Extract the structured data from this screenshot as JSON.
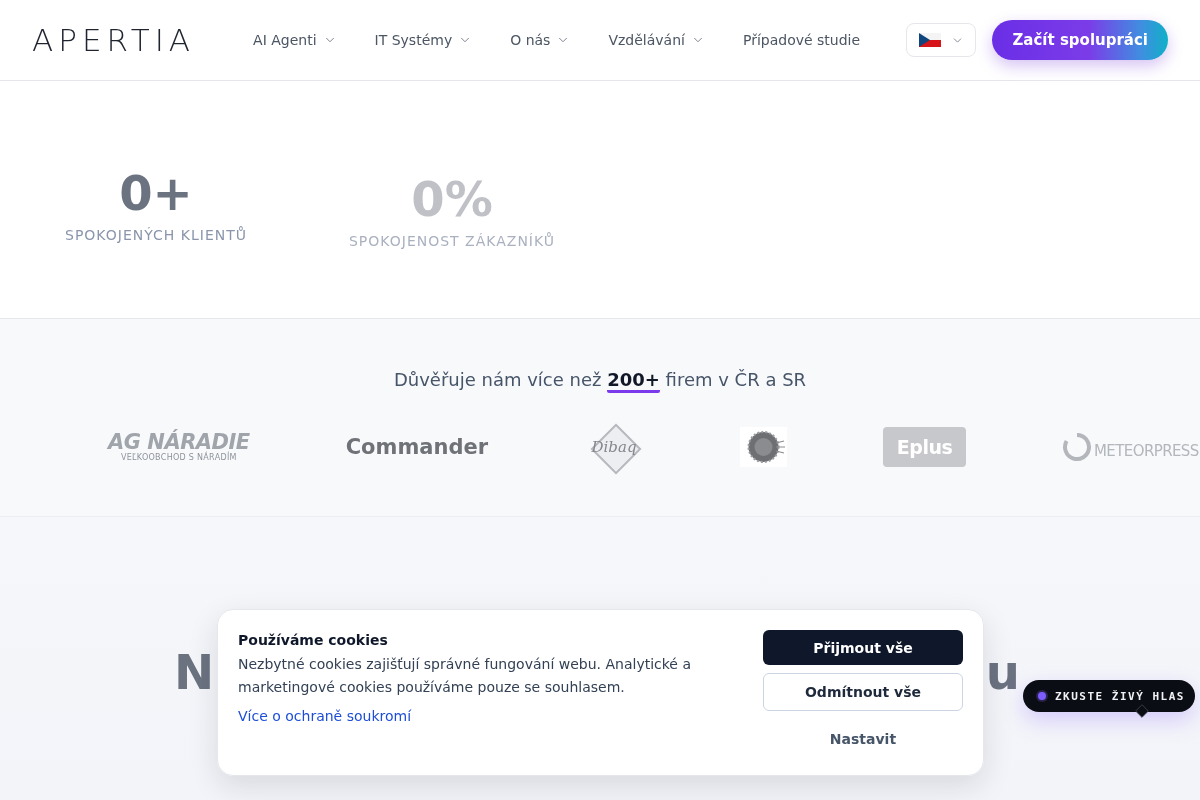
{
  "header": {
    "logo": "APERTIA",
    "nav": [
      {
        "label": "AI Agenti",
        "dropdown": true
      },
      {
        "label": "IT Systémy",
        "dropdown": true
      },
      {
        "label": "O nás",
        "dropdown": true
      },
      {
        "label": "Vzdělávání",
        "dropdown": true
      },
      {
        "label": "Případové studie",
        "dropdown": false
      }
    ],
    "cta": "Začít spolupráci"
  },
  "stats": [
    {
      "value": "0+",
      "label": "SPOKOJENÝCH KLIENTŮ",
      "dimmed": false
    },
    {
      "value": "0%",
      "label": "SPOKOJENOST ZÁKAZNÍKŮ",
      "dimmed": true
    }
  ],
  "clients": {
    "heading": "Důvěřuje nám více než **200+** firem v ČR a SR",
    "logos": [
      {
        "kind": "italic",
        "name": "AG NÁRADIE",
        "tagline": "VEĽKOOBCHOD S NÁRADÍM"
      },
      {
        "kind": "plain",
        "name": "Commander"
      },
      {
        "kind": "diamond",
        "name": "Dibaq"
      },
      {
        "kind": "emblem"
      },
      {
        "kind": "badge",
        "name": "Eplus"
      },
      {
        "kind": "ring",
        "name": "METEORPRESS"
      }
    ]
  },
  "section": {
    "heading_visible": [
      "N",
      "u"
    ]
  },
  "cookie_banner": {
    "title": "Používáme cookies",
    "text": "Nezbytné cookies zajišťují správné fungování webu. Analytické a marketingové cookies používáme pouze se souhlasem.",
    "link": "Více o ochraně soukromí",
    "buttons": [
      {
        "label": "Přijmout vše",
        "kind": "primary"
      },
      {
        "label": "Odmítnout vše",
        "kind": "outline"
      },
      {
        "label": "Nastavit",
        "kind": "text"
      }
    ]
  },
  "voice_pill": {
    "label": "ZKUSTE ŽIVÝ HLAS"
  }
}
